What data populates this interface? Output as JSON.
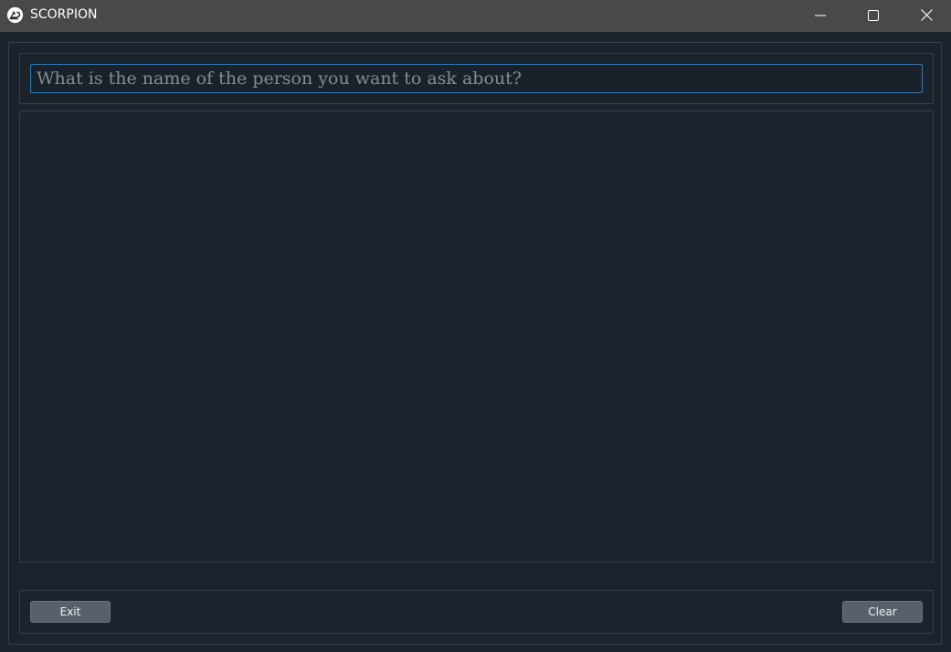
{
  "window": {
    "title": "SCORPION",
    "icon": "app-logo-icon",
    "controls": {
      "minimize": "minimize-icon",
      "maximize": "maximize-icon",
      "close": "close-icon"
    }
  },
  "query": {
    "value": "",
    "placeholder": "What is the name of the person you want to ask about?"
  },
  "output": {
    "text": ""
  },
  "buttons": {
    "exit_label": "Exit",
    "clear_label": "Clear"
  },
  "colors": {
    "titlebar": "#4a4947",
    "background": "#1b232c",
    "input_border_focus": "#2f79b3",
    "button": "#58616b"
  }
}
